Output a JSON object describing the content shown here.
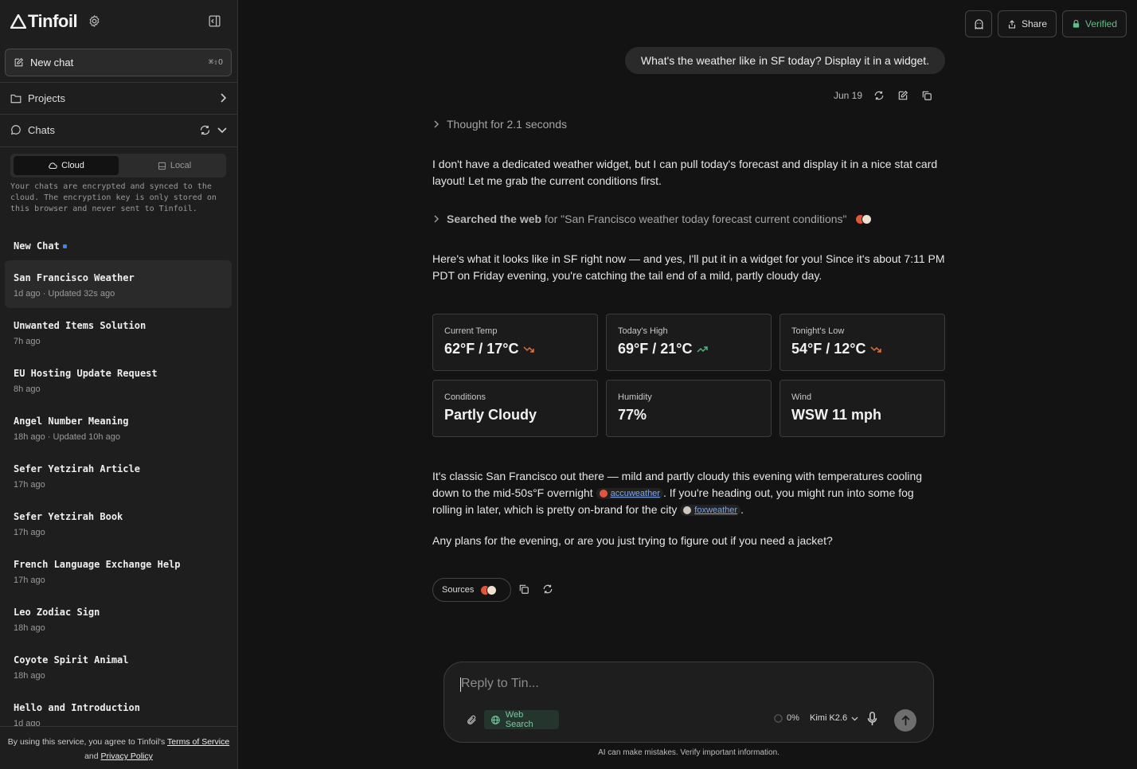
{
  "sidebar": {
    "brand": "Tinfoil",
    "new_chat": {
      "label": "New chat",
      "shortcut": "⌘⇧O"
    },
    "projects_label": "Projects",
    "chats_label": "Chats",
    "storage_tabs": {
      "cloud": "Cloud",
      "local": "Local",
      "selected": "Cloud"
    },
    "encryption_note": "Your chats are encrypted and synced to the cloud. The encryption key is only stored on this browser and never sent to Tinfoil.",
    "chats": [
      {
        "title": "New Chat",
        "subtitle": ""
      },
      {
        "title": "San Francisco Weather",
        "subtitle": "1d ago · Updated 32s ago"
      },
      {
        "title": "Unwanted Items Solution",
        "subtitle": "7h ago"
      },
      {
        "title": "EU Hosting Update Request",
        "subtitle": "8h ago"
      },
      {
        "title": "Angel Number Meaning",
        "subtitle": "18h ago · Updated 10h ago"
      },
      {
        "title": "Sefer Yetzirah Article",
        "subtitle": "17h ago"
      },
      {
        "title": "Sefer Yetzirah Book",
        "subtitle": "17h ago"
      },
      {
        "title": "French Language Exchange Help",
        "subtitle": "17h ago"
      },
      {
        "title": "Leo Zodiac Sign",
        "subtitle": "18h ago"
      },
      {
        "title": "Coyote Spirit Animal",
        "subtitle": "18h ago"
      },
      {
        "title": "Hello and Introduction",
        "subtitle": "1d ago"
      }
    ],
    "footer": {
      "prefix": "By using this service, you agree to Tinfoil's ",
      "terms": "Terms of Service",
      "and": "and ",
      "privacy": "Privacy Policy"
    }
  },
  "topbar": {
    "share": "Share",
    "verified": "Verified"
  },
  "conversation": {
    "user_message": "What's the weather like in SF today? Display it in a widget.",
    "date": "Jun 19",
    "thought": "Thought for 2.1 seconds",
    "intro": "I don't have a dedicated weather widget, but I can pull today's forecast and display it in a nice stat card layout! Let me grab the current conditions first.",
    "search": {
      "prefix": "Searched the web",
      "query": " for \"San Francisco weather today forecast current conditions\""
    },
    "summary": "Here's what it looks like in SF right now — and yes, I'll put it in a widget for you! Since it's about 7:11 PM PDT on Friday evening, you're catching the tail end of a mild, partly cloudy day.",
    "cards": [
      {
        "label": "Current Temp",
        "value": "62°F / 17°C",
        "trend": "down"
      },
      {
        "label": "Today's High",
        "value": "69°F / 21°C",
        "trend": "up"
      },
      {
        "label": "Tonight's Low",
        "value": "54°F / 12°C",
        "trend": "down"
      },
      {
        "label": "Conditions",
        "value": "Partly Cloudy"
      },
      {
        "label": "Humidity",
        "value": "77%"
      },
      {
        "label": "Wind",
        "value": "WSW 11 mph"
      }
    ],
    "closing_1": "It's classic San Francisco out there — mild and partly cloudy this evening with temperatures cooling down to the mid-50s°F overnight ",
    "cite_1": "accuweather",
    "closing_2": ". If you're heading out, you might run into some fog rolling in later, which is pretty on-brand for the city ",
    "cite_2": "foxweather",
    "closing_3": ".",
    "question": "Any plans for the evening, or are you just trying to figure out if you need a jacket?",
    "sources_label": "Sources"
  },
  "composer": {
    "placeholder": "Reply to Tin...",
    "web_search": "Web Search",
    "context_pct": "0%",
    "model": "Kimi K2.6",
    "disclaimer": "AI can make mistakes. Verify important information."
  },
  "colors": {
    "accent_green": "#5fbf8a",
    "trend_up": "#4fb37a",
    "trend_down": "#e0703a",
    "link": "#7fa6e6"
  }
}
